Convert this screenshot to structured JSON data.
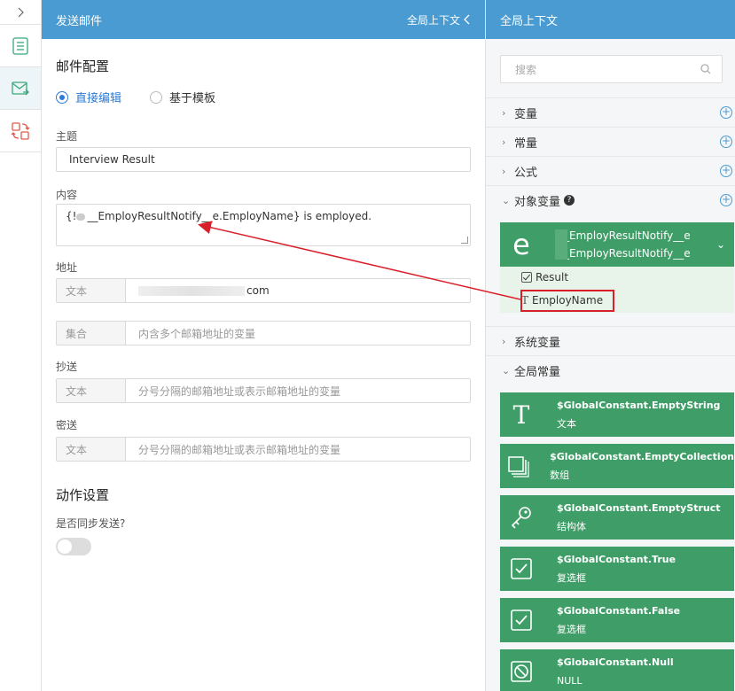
{
  "left_rail": {
    "items": [
      "expand-toggle",
      "list-icon",
      "mail-send-icon",
      "convert-icon"
    ]
  },
  "main": {
    "header_title": "发送邮件",
    "header_context_label": "全局上下文",
    "mail_config_title": "邮件配置",
    "edit_mode": {
      "options": [
        "直接编辑",
        "基于模板"
      ],
      "selected": "直接编辑"
    },
    "subject_label": "主题",
    "subject_value": "Interview Result",
    "content_label": "内容",
    "content_prefix": "{!",
    "content_value": "__EmployResultNotify__e.EmployName} is employed.",
    "address_label": "地址",
    "address_type": "文本",
    "address_value_suffix": "com",
    "collection_type": "集合",
    "collection_placeholder": "内含多个邮箱地址的变量",
    "cc_label": "抄送",
    "cc_type": "文本",
    "cc_placeholder": "分号分隔的邮箱地址或表示邮箱地址的变量",
    "bcc_label": "密送",
    "bcc_type": "文本",
    "bcc_placeholder": "分号分隔的邮箱地址或表示邮箱地址的变量",
    "action_title": "动作设置",
    "sync_label": "是否同步发送?",
    "sync_enabled": false
  },
  "context_panel": {
    "title": "全局上下文",
    "search_placeholder": "搜索",
    "groups": {
      "variables": "变量",
      "constants": "常量",
      "formulas": "公式",
      "object_variables": "对象变量",
      "system_variables": "系统变量",
      "global_constants": "全局常量"
    },
    "object_card": {
      "icon_letter": "e",
      "name_line1": "__EmployResultNotify__e",
      "name_line2": "__EmployResultNotify__e",
      "children": [
        "Result",
        "EmployName"
      ]
    },
    "global_constants": [
      {
        "name": "$GlobalConstant.EmptyString",
        "type": "文本",
        "icon": "text-icon"
      },
      {
        "name": "$GlobalConstant.EmptyCollection",
        "type": "数组",
        "icon": "collection-icon"
      },
      {
        "name": "$GlobalConstant.EmptyStruct",
        "type": "结构体",
        "icon": "key-icon"
      },
      {
        "name": "$GlobalConstant.True",
        "type": "复选框",
        "icon": "checkbox-icon"
      },
      {
        "name": "$GlobalConstant.False",
        "type": "复选框",
        "icon": "checkbox-icon"
      },
      {
        "name": "$GlobalConstant.Null",
        "type": "NULL",
        "icon": "null-icon"
      }
    ]
  },
  "colors": {
    "header_blue": "#4a9bd1",
    "card_green": "#3f9e67",
    "highlight_red": "#d9202a",
    "radio_blue": "#2d7bd6"
  }
}
